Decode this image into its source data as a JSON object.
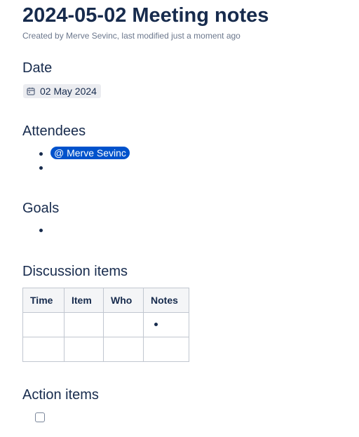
{
  "page": {
    "title": "2024-05-02 Meeting notes",
    "byline": {
      "prefix": "Created by",
      "author": "Merve Sevinc",
      "middle": ", last modified",
      "modified": "just a moment ago"
    }
  },
  "sections": {
    "date": {
      "heading": "Date",
      "value": "02 May 2024",
      "icon": "calendar-icon"
    },
    "attendees": {
      "heading": "Attendees",
      "items": [
        "@ Merve Sevinc",
        ""
      ]
    },
    "goals": {
      "heading": "Goals",
      "items": [
        ""
      ]
    },
    "discussion": {
      "heading": "Discussion items",
      "columns": [
        "Time",
        "Item",
        "Who",
        "Notes"
      ]
    },
    "actions": {
      "heading": "Action items"
    }
  },
  "colors": {
    "text": "#172b4d",
    "muted": "#6b778c",
    "mention": "#0052cc",
    "lozenge": "#ebecf0",
    "table_border": "#c1c7d0",
    "table_header": "#f4f5f7"
  }
}
